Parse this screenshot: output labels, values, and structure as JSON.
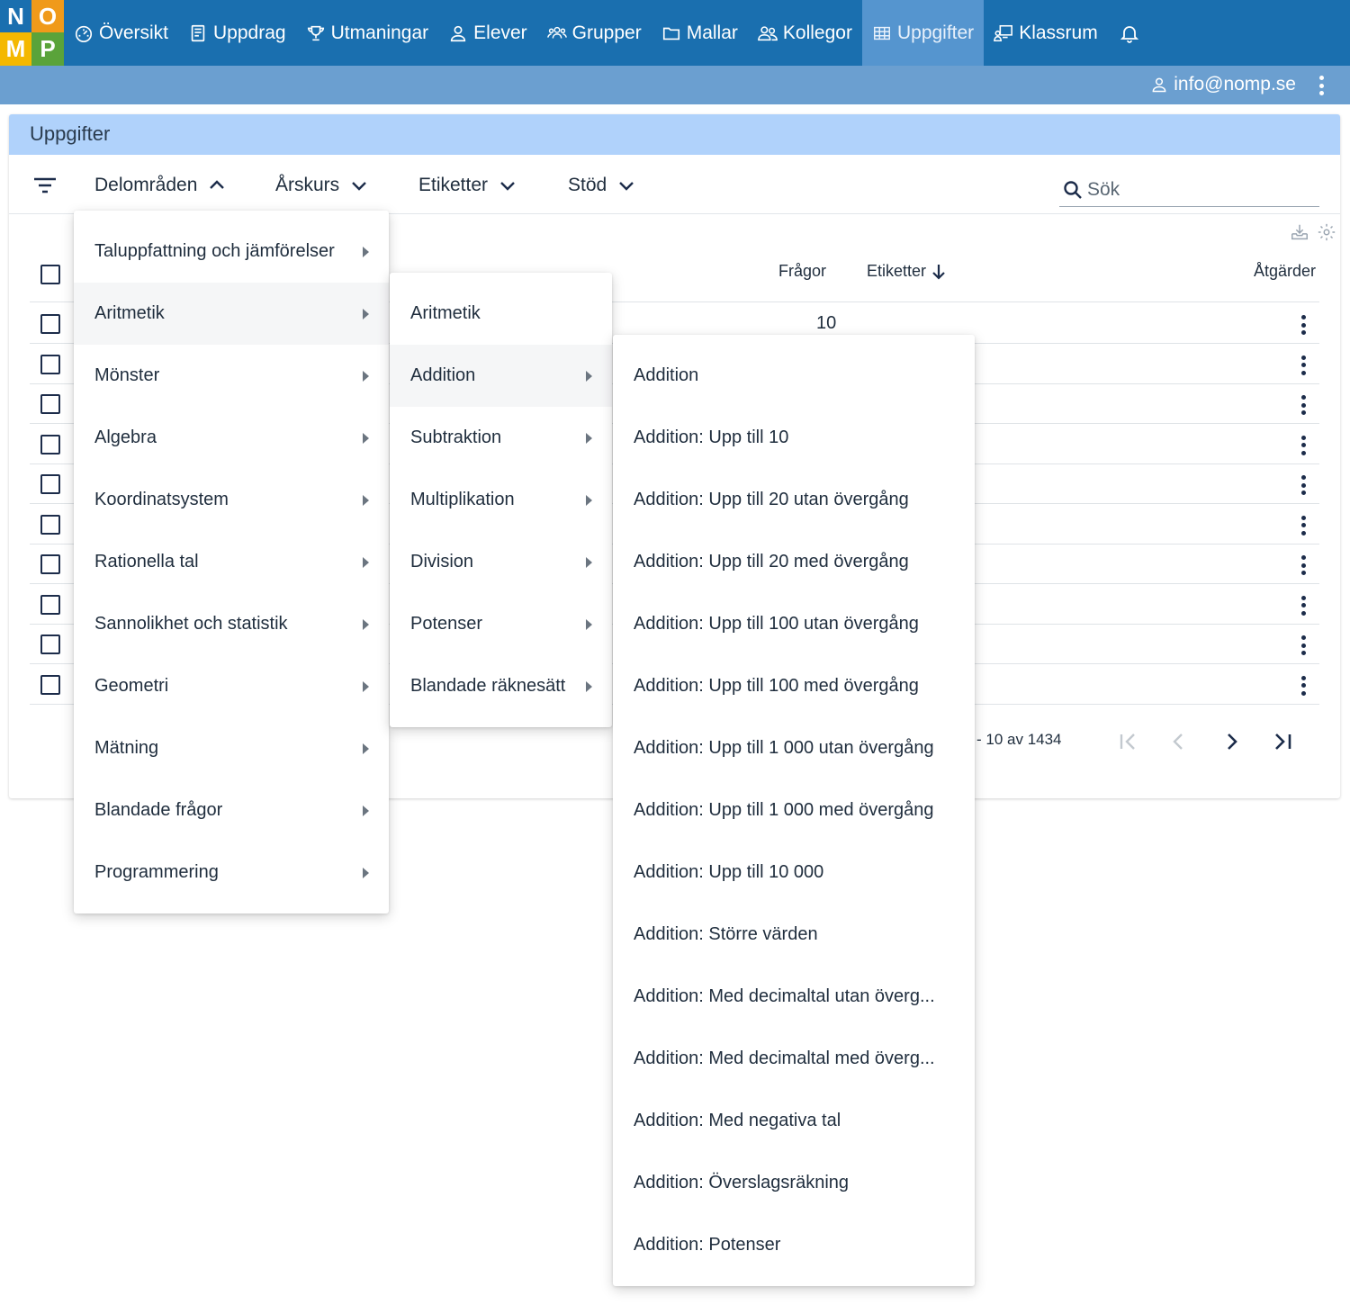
{
  "logo": {
    "letters": [
      "N",
      "O",
      "M",
      "P"
    ],
    "colors": [
      "#1a6faf",
      "#f09a1a",
      "#f4b800",
      "#5aa33a"
    ]
  },
  "nav": {
    "items": [
      {
        "label": "Översikt",
        "icon": "gauge-icon"
      },
      {
        "label": "Uppdrag",
        "icon": "book-icon"
      },
      {
        "label": "Utmaningar",
        "icon": "trophy-icon"
      },
      {
        "label": "Elever",
        "icon": "user-icon"
      },
      {
        "label": "Grupper",
        "icon": "group-icon"
      },
      {
        "label": "Mallar",
        "icon": "folder-icon"
      },
      {
        "label": "Kollegor",
        "icon": "users-icon"
      },
      {
        "label": "Uppgifter",
        "icon": "table-icon",
        "active": true
      },
      {
        "label": "Klassrum",
        "icon": "classroom-icon"
      }
    ],
    "bell_icon": "bell-icon"
  },
  "user": {
    "email": "info@nomp.se"
  },
  "page": {
    "title": "Uppgifter"
  },
  "filters": {
    "delomraden": "Delområden",
    "arskurs": "Årskurs",
    "etiketter": "Etiketter",
    "stod": "Stöd",
    "search_placeholder": "Sök"
  },
  "table": {
    "headers": {
      "fragor": "Frågor",
      "etiketter": "Etiketter",
      "atgarder": "Åtgärder"
    },
    "first_row_fragor": "10",
    "row_count": 10
  },
  "pagination": {
    "range": "- 10 av 1434"
  },
  "menu1": [
    "Taluppfattning och jämförelser",
    "Aritmetik",
    "Mönster",
    "Algebra",
    "Koordinatsystem",
    "Rationella tal",
    "Sannolikhet och statistik",
    "Geometri",
    "Mätning",
    "Blandade frågor",
    "Programmering"
  ],
  "menu2": [
    "Aritmetik",
    "Addition",
    "Subtraktion",
    "Multiplikation",
    "Division",
    "Potenser",
    "Blandade räknesätt"
  ],
  "menu3": [
    "Addition",
    "Addition: Upp till 10",
    "Addition: Upp till 20 utan övergång",
    "Addition: Upp till 20 med övergång",
    "Addition: Upp till 100 utan övergång",
    "Addition: Upp till 100 med övergång",
    "Addition: Upp till 1 000 utan övergång",
    "Addition: Upp till 1 000 med övergång",
    "Addition: Upp till 10 000",
    "Addition: Större värden",
    "Addition: Med decimaltal utan överg...",
    "Addition: Med decimaltal med överg...",
    "Addition: Med negativa tal",
    "Addition: Överslagsräkning",
    "Addition: Potenser"
  ]
}
